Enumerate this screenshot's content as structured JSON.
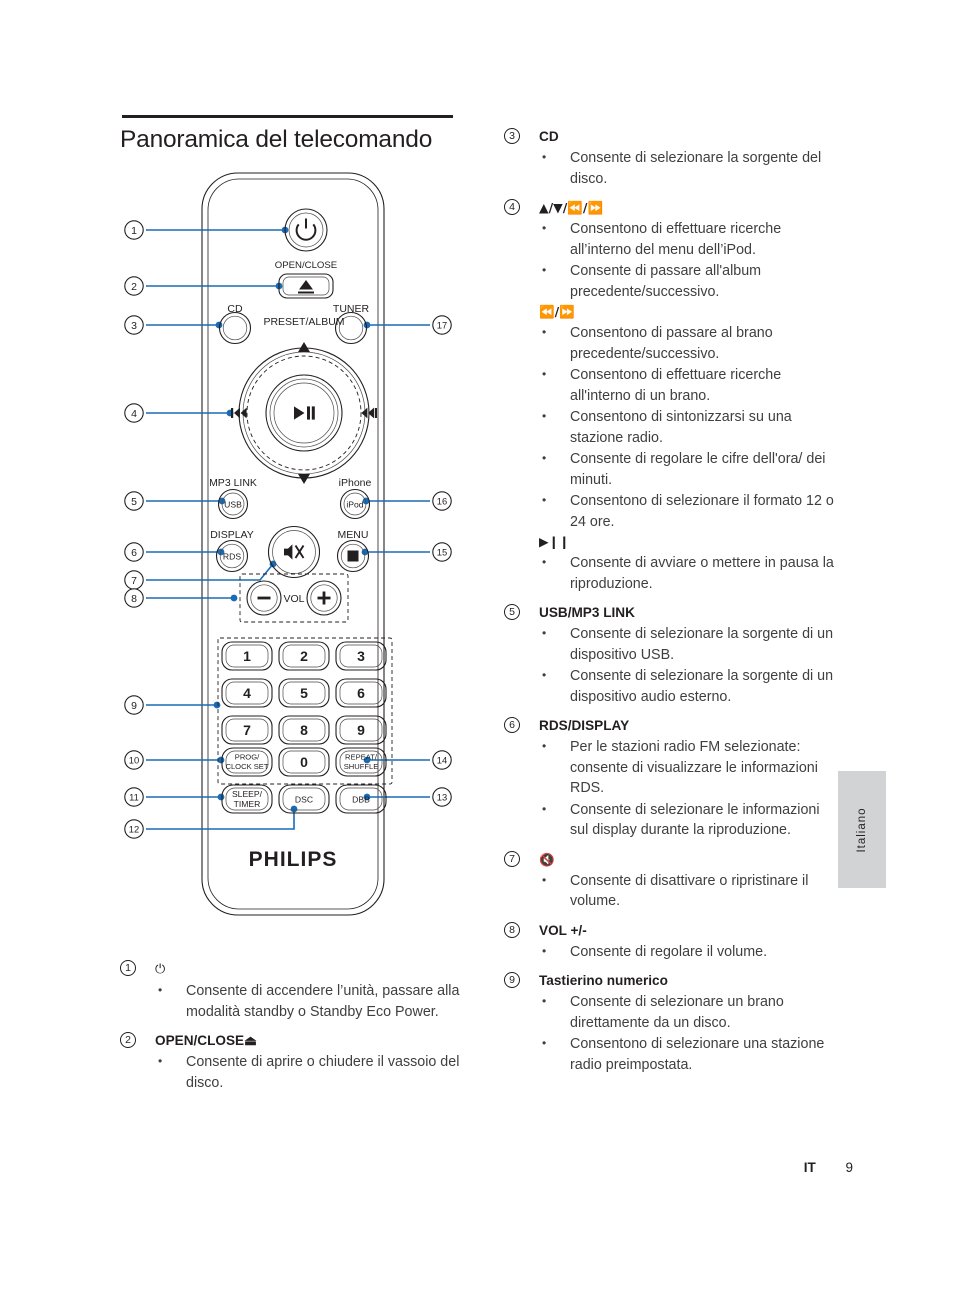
{
  "page": {
    "title": "Panoramica del telecomando",
    "language_tab": "Italiano",
    "footer_locale": "IT",
    "footer_page": "9",
    "brand": "PHILIPS"
  },
  "colors": {
    "callout_blue": "#1a6bb5",
    "ink": "#231f20",
    "body_text": "#3f3f41",
    "tab_gray": "#d2d3d5",
    "device_outline": "#231f20"
  },
  "remote": {
    "brand_label": "PHILIPS",
    "buttons": [
      {
        "id": "power",
        "label": "",
        "icon": "power-icon",
        "callout": "1"
      },
      {
        "id": "open-close",
        "label": "OPEN/CLOSE",
        "icon": "eject-icon",
        "callout": "2"
      },
      {
        "id": "cd",
        "label": "CD",
        "callout": "3"
      },
      {
        "id": "tuner",
        "label": "TUNER",
        "callout": "17"
      },
      {
        "id": "preset-album",
        "label": "PRESET/ALBUM",
        "callout": "4"
      },
      {
        "id": "play-pause",
        "label": "▶❙❙",
        "callout": ""
      },
      {
        "id": "usb",
        "label": "USB",
        "top_label": "MP3 LINK",
        "callout": "5"
      },
      {
        "id": "ipod",
        "label": "iPod",
        "top_label": "iPhone",
        "callout": "16"
      },
      {
        "id": "rds",
        "label": "RDS",
        "top_label": "DISPLAY",
        "callout": "6"
      },
      {
        "id": "mute",
        "label": "",
        "icon": "mute-icon",
        "callout": "7"
      },
      {
        "id": "stop-menu",
        "label": "",
        "top_label": "MENU",
        "icon": "stop-icon",
        "callout": "15"
      },
      {
        "id": "vol",
        "label": "VOL",
        "minus": "−",
        "plus": "+",
        "callout": "8"
      },
      {
        "id": "keypad",
        "label": "",
        "callout": "9"
      },
      {
        "id": "prog-clock-set",
        "label_line1": "PROG/",
        "label_line2": "CLOCK SET",
        "callout": "10"
      },
      {
        "id": "repeat-shuffle",
        "label_line1": "REPEAT/",
        "label_line2": "SHUFFLE",
        "callout": "14"
      },
      {
        "id": "sleep-timer",
        "label_line1": "SLEEP/",
        "label_line2": "TIMER",
        "callout": "11"
      },
      {
        "id": "dsc",
        "label": "DSC",
        "callout": "12"
      },
      {
        "id": "dbb",
        "label": "DBB",
        "callout": "13"
      }
    ],
    "keypad_keys": [
      "1",
      "2",
      "3",
      "4",
      "5",
      "6",
      "7",
      "8",
      "9",
      "0"
    ]
  },
  "left_entries": [
    {
      "num": "1",
      "title": "⏻",
      "title_is_glyph": true,
      "bullets": [
        "Consente di accendere l’unità, passare alla modalità standby o Standby Eco Power."
      ]
    },
    {
      "num": "2",
      "title": "OPEN/CLOSE⏏",
      "bullets": [
        "Consente di aprire o chiudere il vassoio del disco."
      ]
    }
  ],
  "right_entries": [
    {
      "num": "3",
      "title": "CD",
      "bullets": [
        "Consente di selezionare la sorgente del disco."
      ]
    },
    {
      "num": "4",
      "title": "▲/▼/⏪/⏩",
      "title_is_glyph": true,
      "bullets": [
        "Consentono di effettuare ricerche all’interno del menu dell’iPod.",
        "Consente di passare all'album precedente/successivo."
      ],
      "subsections": [
        {
          "sub_title": "⏪/⏩",
          "bullets": [
            "Consentono di passare al brano precedente/successivo.",
            "Consentono di effettuare ricerche all'interno di un brano.",
            "Consentono di sintonizzarsi su una stazione radio.",
            "Consente di regolare le cifre dell'ora/ dei minuti.",
            "Consentono di selezionare il formato 12 o 24 ore."
          ]
        },
        {
          "sub_title": "▶❙❙",
          "bullets": [
            "Consente di avviare o mettere in pausa la riproduzione."
          ]
        }
      ]
    },
    {
      "num": "5",
      "title": "USB/MP3 LINK",
      "bullets": [
        "Consente di selezionare la sorgente di un dispositivo USB.",
        "Consente di selezionare la sorgente di un dispositivo audio esterno."
      ]
    },
    {
      "num": "6",
      "title": "RDS/DISPLAY",
      "bullets": [
        "Per le stazioni radio FM selezionate: consente di visualizzare le informazioni RDS.",
        "Consente di selezionare le informazioni sul display durante la riproduzione."
      ]
    },
    {
      "num": "7",
      "title": "🔇",
      "title_is_glyph": true,
      "bullets": [
        "Consente di disattivare o ripristinare il volume."
      ]
    },
    {
      "num": "8",
      "title": "VOL +/-",
      "bullets": [
        "Consente di regolare il volume."
      ]
    },
    {
      "num": "9",
      "title": "Tastierino numerico",
      "bullets": [
        "Consente di selezionare un brano direttamente da un disco.",
        "Consentono di selezionare una stazione radio preimpostata."
      ]
    }
  ]
}
